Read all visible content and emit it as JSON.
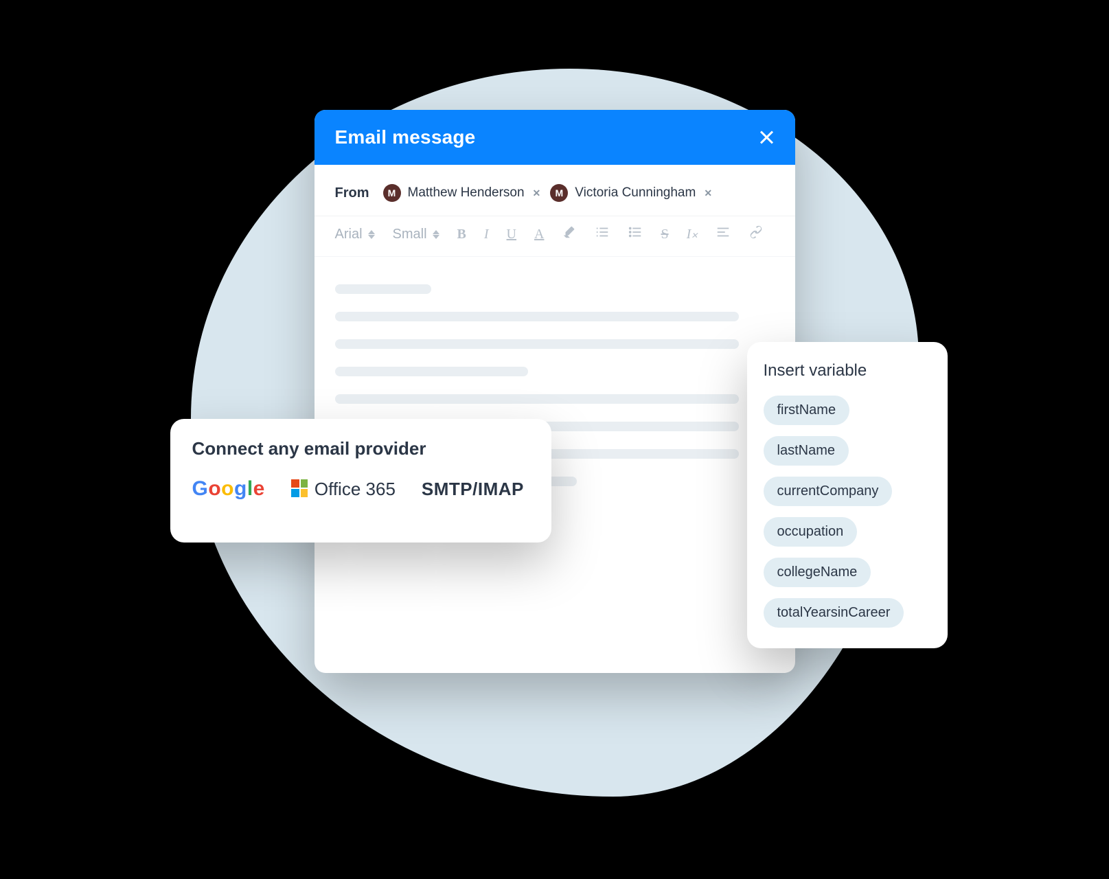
{
  "composer": {
    "title": "Email message",
    "from_label": "From",
    "senders": [
      {
        "initial": "M",
        "name": "Matthew Henderson"
      },
      {
        "initial": "M",
        "name": "Victoria Cunningham"
      }
    ],
    "toolbar": {
      "font": "Arial",
      "size": "Small"
    }
  },
  "providers": {
    "title": "Connect any email provider",
    "office_label": "Office 365",
    "smtp_label": "SMTP/IMAP"
  },
  "variables": {
    "title": "Insert variable",
    "items": [
      "firstName",
      "lastName",
      "currentCompany",
      "occupation",
      "collegeName",
      "totalYearsinCareer"
    ]
  },
  "colors": {
    "accent": "#0a84ff",
    "blob": "#d8e6ee",
    "pill": "#e1edf3"
  }
}
